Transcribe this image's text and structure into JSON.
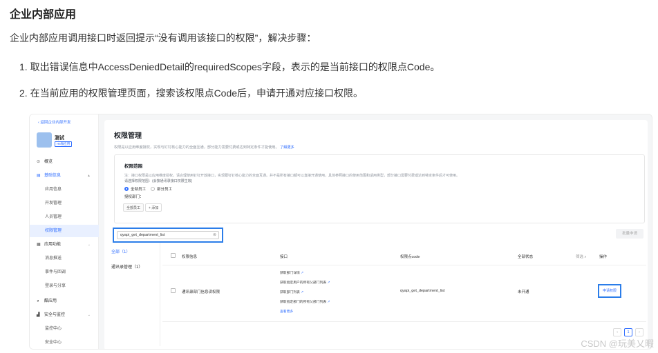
{
  "doc": {
    "title": "企业内部应用",
    "intro": "企业内部应用调用接口时返回提示“没有调用该接口的权限”，解决步骤：",
    "step1": "1. 取出错误信息中AccessDeniedDetail的requiredScopes字段，表示的是当前接口的权限点Code。",
    "step2": "2. 在当前应用的权限管理页面，搜索该权限点Code后，申请开通对应接口权限。"
  },
  "sidebar": {
    "back": "返回企业内部开发",
    "app_name": "测试",
    "app_tag": "H5微应用",
    "items": [
      {
        "label": "概览",
        "icon": "home-icon"
      },
      {
        "label": "基础信息",
        "icon": "doc-icon",
        "chevron": "▲"
      },
      {
        "label": "应用信息"
      },
      {
        "label": "开发管理"
      },
      {
        "label": "人员管理"
      },
      {
        "label": "权限管理"
      },
      {
        "label": "应用功能",
        "icon": "grid-icon",
        "chevron": "⌄"
      },
      {
        "label": "消息推送"
      },
      {
        "label": "事件与回调"
      },
      {
        "label": "登录与分享"
      },
      {
        "label": "酷应用",
        "icon": "cool-icon"
      },
      {
        "label": "安全与监控",
        "icon": "chart-icon",
        "chevron": "⌄"
      },
      {
        "label": "监控中心"
      },
      {
        "label": "安全中心"
      }
    ]
  },
  "main": {
    "title": "权限管理",
    "desc": "权限是以应用维度授权，实现与钉钉核心能力的全面互通，部分能力需要付费或达到特定条件才能使用。",
    "desc_link": "了解更多",
    "scope": {
      "title": "权限范围",
      "note": "注：接口权限是以应用维度授权，请合理使用钉钉开放接口，实现跟钉钉核心能力的全面互通。并不是所有接口都可以直接开通使用，具体参照接口的使用范围和适用类型，部分接口需要付费或达到特定条件后才可使用。",
      "hint": "请选择权限范围：(会按通讯录接口权限生效)",
      "radio_all": "全部员工",
      "radio_part": "部分员工",
      "auth_label": "授权部门：",
      "chip_all": "全部员工",
      "chip_add": "+ 添加"
    },
    "search_value": "qyapi_get_department_list",
    "search_clear": "⊗",
    "batch_btn": "批量申请",
    "categories": [
      "全部（1）",
      "通讯录管理（1）"
    ],
    "table": {
      "headers": [
        "权限信息",
        "接口",
        "权限点code",
        "全部状态",
        "筛选 ⌕",
        "操作"
      ],
      "row": {
        "perm": "通讯录部门信息读权限",
        "apis": [
          "获取部门详情",
          "获取指定用户的所有父部门列表",
          "获取部门列表",
          "获取指定部门的所有父部门列表"
        ],
        "api_link": "↗",
        "more": "查看更多",
        "code": "qyapi_get_department_list",
        "status": "未开通",
        "action": "申请权限"
      }
    },
    "pager": {
      "prev": "‹",
      "page": "1",
      "next": "›"
    }
  },
  "watermark": "CSDN @玩美乂暇"
}
